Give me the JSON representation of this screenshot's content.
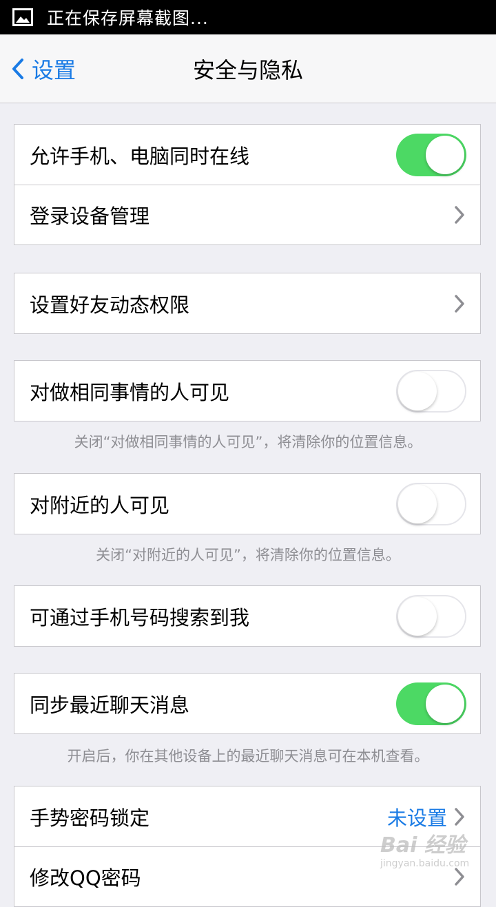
{
  "status_bar": {
    "text": "正在保存屏幕截图..."
  },
  "nav": {
    "back_label": "设置",
    "title": "安全与隐私"
  },
  "groups": [
    {
      "rows": [
        {
          "label": "允许手机、电脑同时在线",
          "toggle": true
        },
        {
          "label": "登录设备管理"
        }
      ]
    },
    {
      "rows": [
        {
          "label": "设置好友动态权限"
        }
      ]
    },
    {
      "rows": [
        {
          "label": "对做相同事情的人可见",
          "toggle": false
        }
      ],
      "note": "关闭“对做相同事情的人可见”，将清除你的位置信息。"
    },
    {
      "rows": [
        {
          "label": "对附近的人可见",
          "toggle": false
        }
      ],
      "note": "关闭“对附近的人可见”，将清除你的位置信息。"
    },
    {
      "rows": [
        {
          "label": "可通过手机号码搜索到我",
          "toggle": false
        }
      ]
    },
    {
      "rows": [
        {
          "label": "同步最近聊天消息",
          "toggle": true
        }
      ],
      "note": "开启后，你在其他设备上的最近聊天消息可在本机查看。"
    },
    {
      "rows": [
        {
          "label": "手势密码锁定",
          "value": "未设置"
        },
        {
          "label": "修改QQ密码"
        }
      ]
    }
  ],
  "watermark": {
    "main": "Bai 经验",
    "sub": "jingyan.baidu.com"
  },
  "colors": {
    "accent": "#1a7be5",
    "toggle_on": "#4cd964",
    "background": "#efeff4"
  }
}
